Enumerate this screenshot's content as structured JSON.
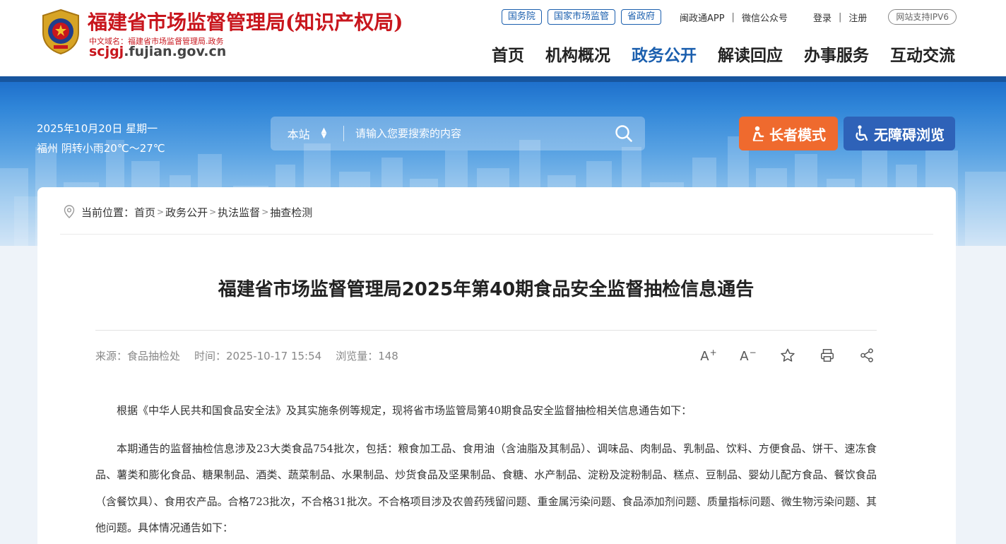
{
  "site": {
    "title": "福建省市场监督管理局(知识产权局)",
    "domain_cn": "中文域名：福建省市场监督管理局.政务",
    "url_prefix": "scjgj",
    "url_rest": ".fujian.gov.cn"
  },
  "top_links": {
    "pills": [
      "国务院",
      "国家市场监管",
      "省政府"
    ],
    "app": "闽政通APP",
    "wechat": "微信公众号",
    "login": "登录",
    "register": "注册",
    "ipv6": "网站支持IPV6"
  },
  "nav": {
    "items": [
      "首页",
      "机构概况",
      "政务公开",
      "解读回应",
      "办事服务",
      "互动交流"
    ],
    "active": "政务公开"
  },
  "banner": {
    "date": "2025年10月20日 星期一",
    "weather": "福州 阴转小雨20℃～27℃",
    "search_scope": "本站",
    "search_placeholder": "请输入您要搜索的内容",
    "elder_mode": "长者模式",
    "accessible": "无障碍浏览"
  },
  "breadcrumb": {
    "label": "当前位置：",
    "items": [
      "首页",
      "政务公开",
      "执法监督",
      "抽查检测"
    ]
  },
  "article": {
    "title": "福建省市场监督管理局2025年第40期食品安全监督抽检信息通告",
    "source": "来源：食品抽检处",
    "time": "时间：2025-10-17 15:54",
    "views": "浏览量：148",
    "tools": {
      "font_up": "A",
      "font_up_sign": "+",
      "font_down": "A",
      "font_down_sign": "−"
    },
    "paragraphs": [
      "根据《中华人民共和国食品安全法》及其实施条例等规定，现将省市场监管局第40期食品安全监督抽检相关信息通告如下：",
      "本期通告的监督抽检信息涉及23大类食品754批次，包括：粮食加工品、食用油（含油脂及其制品）、调味品、肉制品、乳制品、饮料、方便食品、饼干、速冻食品、薯类和膨化食品、糖果制品、酒类、蔬菜制品、水果制品、炒货食品及坚果制品、食糖、水产制品、淀粉及淀粉制品、糕点、豆制品、婴幼儿配方食品、餐饮食品（含餐饮具）、食用农产品。合格723批次，不合格31批次。不合格项目涉及农兽药残留问题、重金属污染问题、食品添加剂问题、质量指标问题、微生物污染问题、其他问题。具体情况通告如下："
    ]
  },
  "colors": {
    "brand_red": "#c8161d",
    "brand_blue": "#1b5fae",
    "elder_orange": "#ef6a2e",
    "access_blue": "#2e62b8"
  }
}
